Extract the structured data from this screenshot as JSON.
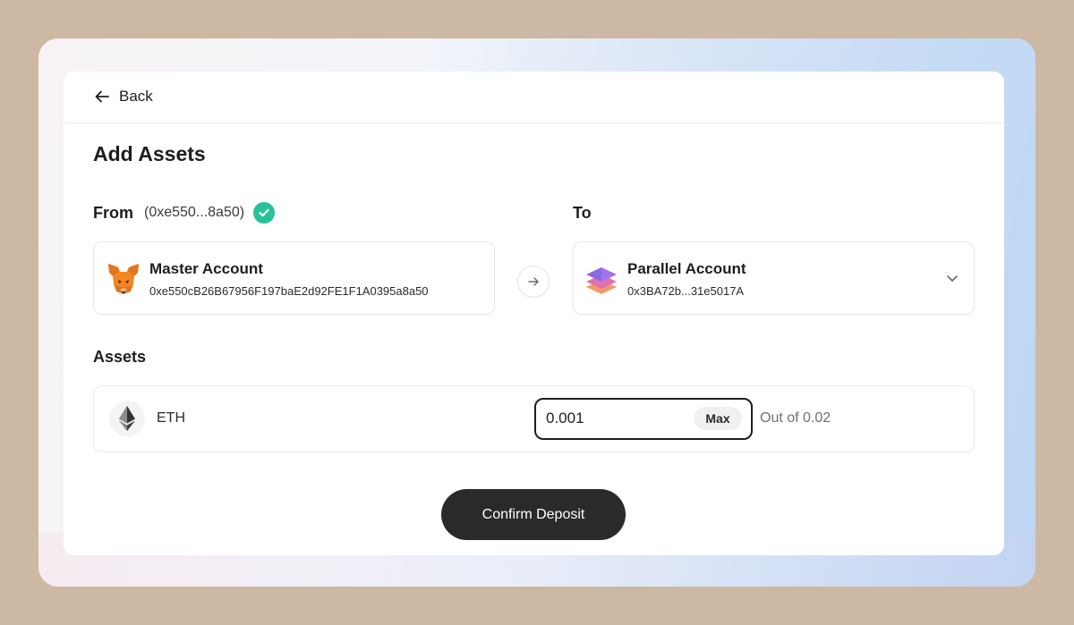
{
  "nav": {
    "back_label": "Back"
  },
  "page": {
    "title": "Add Assets"
  },
  "from": {
    "label": "From",
    "address_short": "(0xe550...8a50)",
    "account_name": "Master Account",
    "account_address": "0xe550cB26B67956F197baE2d92FE1F1A0395a8a50",
    "wallet_icon": "metamask-fox-icon",
    "verified_icon": "check-circle-icon"
  },
  "to": {
    "label": "To",
    "account_name": "Parallel Account",
    "account_address": "0x3BA72b...31e5017A",
    "account_icon": "parallel-layers-icon"
  },
  "assets": {
    "label": "Assets",
    "items": [
      {
        "symbol": "ETH",
        "icon": "ethereum-icon",
        "amount": "0.001",
        "max_label": "Max",
        "balance_text": "Out of 0.02"
      }
    ]
  },
  "actions": {
    "confirm_label": "Confirm Deposit"
  },
  "colors": {
    "verified": "#27c29a",
    "primary_button": "#2a2a2a"
  }
}
